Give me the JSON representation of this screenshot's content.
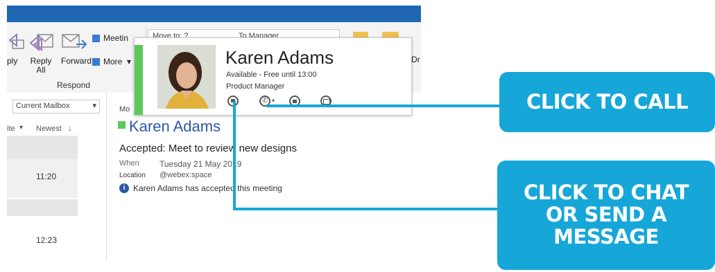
{
  "ribbon": {
    "reply_partial": "ply",
    "reply_all_line1": "Reply",
    "reply_all_line2": "All",
    "forward": "Forward",
    "meeting": "Meetin",
    "more": "More",
    "respond_group": "Respond",
    "move_to": "Move to: ?",
    "to_manager": "To Manager",
    "right_partial": "Dr"
  },
  "mail_list": {
    "scope": "Current Mailbox",
    "sort_by_partial": "ite",
    "sort_order": "Newest",
    "times": [
      "11:20",
      "12:23"
    ]
  },
  "reading": {
    "more_partial": "Mo",
    "sender": "Karen Adams",
    "subject": "Accepted: Meet to review new designs",
    "when_label": "When",
    "when_value": "Tuesday 21 May 2019",
    "location_label": "Location",
    "location_value": "@webex:space",
    "info": "Karen Adams has accepted this meeting"
  },
  "contact_card": {
    "name": "Karen Adams",
    "presence": "Available - Free until 13:00",
    "title": "Product Manager",
    "presence_color": "#5cc85c"
  },
  "callouts": {
    "call": "CLICK TO CALL",
    "chat_line1": "CLICK TO CHAT",
    "chat_line2": "OR SEND A",
    "chat_line3": "MESSAGE"
  },
  "colors": {
    "accent": "#16a7d8",
    "titlebar": "#1f67b3",
    "sender_link": "#2e58a8"
  }
}
